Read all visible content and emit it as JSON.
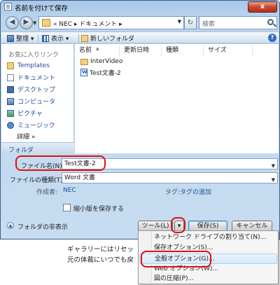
{
  "window": {
    "title": "名前を付けて保存",
    "close_label": "x"
  },
  "address": {
    "path": "« NEC ▸ ドキュメント ▸",
    "search_placeholder": "検索"
  },
  "toolbar": {
    "organize": "整理 ▾",
    "views": "表示 ▾",
    "new_folder": "新しいフォルダ",
    "help": "?"
  },
  "nav": {
    "favorites_header": "お気に入りリンク",
    "items": [
      {
        "label": "Templates",
        "icon": "folder-icon"
      },
      {
        "label": "ドキュメント",
        "icon": "documents-icon"
      },
      {
        "label": "デスクトップ",
        "icon": "desktop-icon"
      },
      {
        "label": "コンピュータ",
        "icon": "computer-icon"
      },
      {
        "label": "ピクチャ",
        "icon": "pictures-icon"
      },
      {
        "label": "ミュージック",
        "icon": "music-icon"
      }
    ],
    "more": "詳細 »",
    "folder_pane": "フォルダ"
  },
  "filelist": {
    "columns": [
      "名前",
      "更新日時",
      "種類",
      "サイズ"
    ],
    "rows": [
      {
        "name": "InterVideo",
        "icon": "folder-icon"
      },
      {
        "name": "Test文書-2",
        "icon": "word-doc-icon"
      }
    ]
  },
  "form": {
    "filename_label": "ファイル名(N):",
    "filename_value": "Test文書-2",
    "filetype_label": "ファイルの種類(T):",
    "filetype_value": "Word 文書",
    "author_label": "作成者:",
    "author_value": "NEC",
    "tags_label": "タグ:",
    "tags_value": "タグの追加",
    "thumbnail_label": "縮小版を保存する"
  },
  "footer": {
    "hide_folders": "フォルダの非表示",
    "tools": "ツール(L)",
    "tools_arrow": "▾",
    "save": "保存(S)",
    "cancel": "キャンセル"
  },
  "tools_menu": {
    "items": [
      "ネットワーク ドライブの割り当て(N)...",
      "保存オプション(S)...",
      "全般オプション(G)...",
      "Web オプション(W)...",
      "図の圧縮(P)..."
    ]
  },
  "background_doc": {
    "lines": [
      "ギャラリーにはリセッ",
      "元の体裁にいつでも戻"
    ]
  },
  "colors": {
    "highlight": "#e01010",
    "link": "#1a4f9c",
    "frame": "#bcd6ee"
  }
}
